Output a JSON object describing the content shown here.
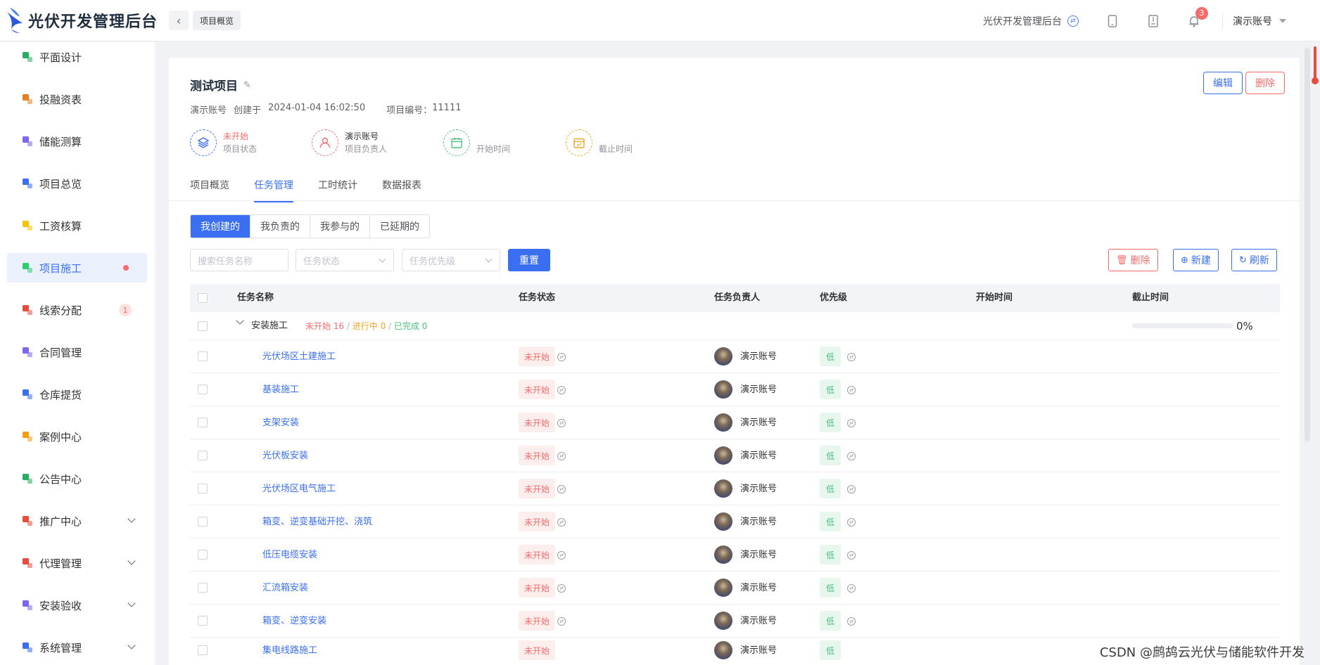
{
  "header": {
    "logo_text": "光伏开发管理后台",
    "crumb": "项目概览",
    "system_name": "光伏开发管理后台",
    "notification_count": "3",
    "user_name": "演示账号"
  },
  "sidebar": {
    "items": [
      {
        "label": "平面设计",
        "icon": "layout-icon",
        "color": "#27ae60"
      },
      {
        "label": "投融资表",
        "icon": "finance-icon",
        "color": "#e67e22"
      },
      {
        "label": "储能测算",
        "icon": "calc-icon",
        "color": "#7b68ee"
      },
      {
        "label": "项目总览",
        "icon": "layers-icon",
        "color": "#3a6ff2"
      },
      {
        "label": "工资核算",
        "icon": "salary-icon",
        "color": "#f1c40f"
      },
      {
        "label": "项目施工",
        "icon": "construction-icon",
        "color": "#2ecc71",
        "active": true,
        "dot": true
      },
      {
        "label": "线索分配",
        "icon": "clue-icon",
        "color": "#e74c3c",
        "count": "1"
      },
      {
        "label": "合同管理",
        "icon": "contract-icon",
        "color": "#7b68ee"
      },
      {
        "label": "仓库提货",
        "icon": "warehouse-icon",
        "color": "#3a6ff2"
      },
      {
        "label": "案例中心",
        "icon": "case-icon",
        "color": "#f39c12"
      },
      {
        "label": "公告中心",
        "icon": "bell-icon",
        "color": "#27ae60"
      },
      {
        "label": "推广中心",
        "icon": "send-icon",
        "color": "#e74c3c",
        "expandable": true
      },
      {
        "label": "代理管理",
        "icon": "agent-icon",
        "color": "#e74c3c",
        "expandable": true
      },
      {
        "label": "安装验收",
        "icon": "tools-icon",
        "color": "#7b68ee",
        "expandable": true
      },
      {
        "label": "系统管理",
        "icon": "settings-icon",
        "color": "#3a6ff2",
        "expandable": true
      }
    ]
  },
  "project": {
    "title": "测试项目",
    "edit_label": "编辑",
    "delete_label": "删除",
    "owner": "演示账号",
    "created_prefix": "创建于",
    "created_at": "2024-01-04 16:02:50",
    "code_label": "项目编号：",
    "code": "11111",
    "info": [
      {
        "top": "未开始",
        "bottom": "项目状态"
      },
      {
        "top": "演示账号",
        "bottom": "项目负责人"
      },
      {
        "top": "",
        "bottom": "开始时间"
      },
      {
        "top": "",
        "bottom": "截止时间"
      }
    ]
  },
  "tabs": [
    "项目概览",
    "任务管理",
    "工时统计",
    "数据报表"
  ],
  "segments": [
    "我创建的",
    "我负责的",
    "我参与的",
    "已延期的"
  ],
  "filters": {
    "search_placeholder": "搜索任务名称",
    "status_placeholder": "任务状态",
    "priority_placeholder": "任务优先级",
    "reset_label": "重置"
  },
  "toolbar": {
    "delete_label": "删除",
    "new_label": "新建",
    "refresh_label": "刷新"
  },
  "table": {
    "headers": [
      "任务名称",
      "任务状态",
      "任务负责人",
      "优先级",
      "开始时间",
      "截止时间"
    ],
    "group": {
      "name": "安装施工",
      "not_started": "未开始 16",
      "in_progress": "进行中 0",
      "completed": "已完成 0",
      "progress_text": "0%"
    },
    "rows": [
      {
        "name": "光伏场区土建施工",
        "status": "未开始",
        "owner": "演示账号",
        "priority": "低"
      },
      {
        "name": "基装施工",
        "status": "未开始",
        "owner": "演示账号",
        "priority": "低"
      },
      {
        "name": "支架安装",
        "status": "未开始",
        "owner": "演示账号",
        "priority": "低"
      },
      {
        "name": "光伏板安装",
        "status": "未开始",
        "owner": "演示账号",
        "priority": "低"
      },
      {
        "name": "光伏场区电气施工",
        "status": "未开始",
        "owner": "演示账号",
        "priority": "低"
      },
      {
        "name": "箱变、逆变基础开挖、浇筑",
        "status": "未开始",
        "owner": "演示账号",
        "priority": "低"
      },
      {
        "name": "低压电缆安装",
        "status": "未开始",
        "owner": "演示账号",
        "priority": "低"
      },
      {
        "name": "汇流箱安装",
        "status": "未开始",
        "owner": "演示账号",
        "priority": "低"
      },
      {
        "name": "箱变、逆变安装",
        "status": "未开始",
        "owner": "演示账号",
        "priority": "低"
      }
    ]
  },
  "watermark": "CSDN @鹧鸪云光伏与储能软件开发"
}
